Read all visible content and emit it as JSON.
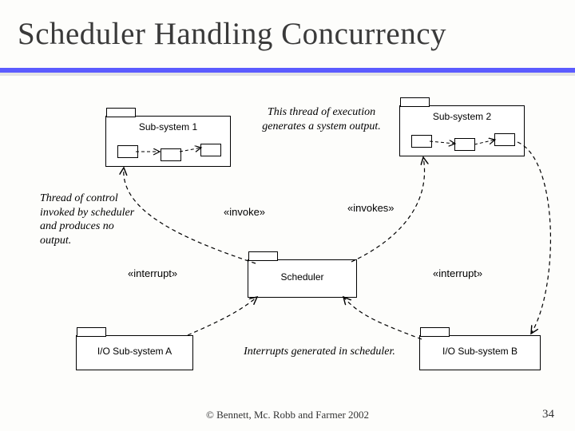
{
  "title": "Scheduler Handling Concurrency",
  "packages": {
    "sub1": "Sub-system 1",
    "sub2": "Sub-system 2",
    "scheduler": "Scheduler",
    "ioA": "I/O Sub-system A",
    "ioB": "I/O Sub-system B"
  },
  "stereotypes": {
    "invoke": "«invoke»",
    "invokes": "«invokes»",
    "interrupt_left": "«interrupt»",
    "interrupt_right": "«interrupt»"
  },
  "notes": {
    "top_center": "This thread of execution generates a system output.",
    "left": "Thread of control invoked by scheduler and produces no output.",
    "bottom_center": "Interrupts generated in scheduler."
  },
  "footer": "©  Bennett, Mc. Robb and Farmer 2002",
  "page_number": "34"
}
